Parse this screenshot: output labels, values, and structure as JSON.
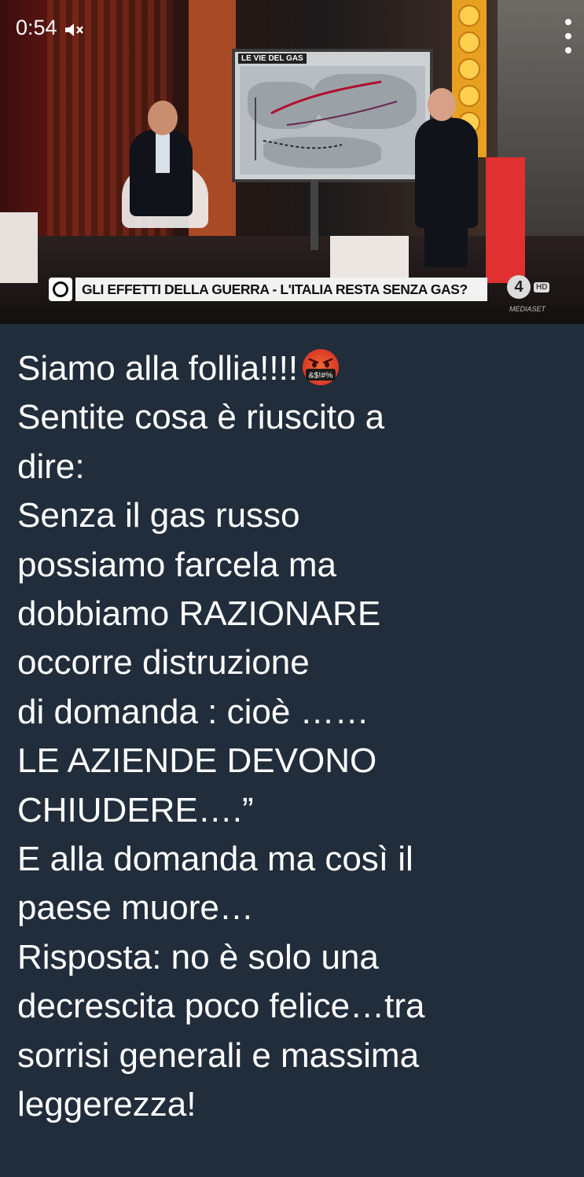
{
  "status_bar": {
    "time": "0:54",
    "mute_icon": "volume-muted-icon",
    "menu_icon": "more-vertical-icon"
  },
  "video": {
    "screen_title": "LE VIE DEL GAS",
    "ticker_text": "GLI EFFETTI DELLA GUERRA - L'ITALIA RESTA SENZA GAS?",
    "channel_number": "4",
    "channel_badge": "HD",
    "brand": "MEDIASET"
  },
  "message": {
    "emoji": "face-with-symbols-on-mouth",
    "lines": [
      "Siamo alla follia!!!!",
      "Sentite cosa è riuscito a",
      "dire:",
      "Senza il gas russo",
      "possiamo farcela ma",
      "dobbiamo RAZIONARE",
      "occorre distruzione",
      "di domanda : cioè ……",
      "LE AZIENDE DEVONO",
      "CHIUDERE….”",
      "E alla domanda ma così il",
      "paese muore…",
      "Risposta: no è solo una",
      "decrescita poco felice…tra",
      "sorrisi generali e massima",
      "leggerezza!"
    ]
  }
}
